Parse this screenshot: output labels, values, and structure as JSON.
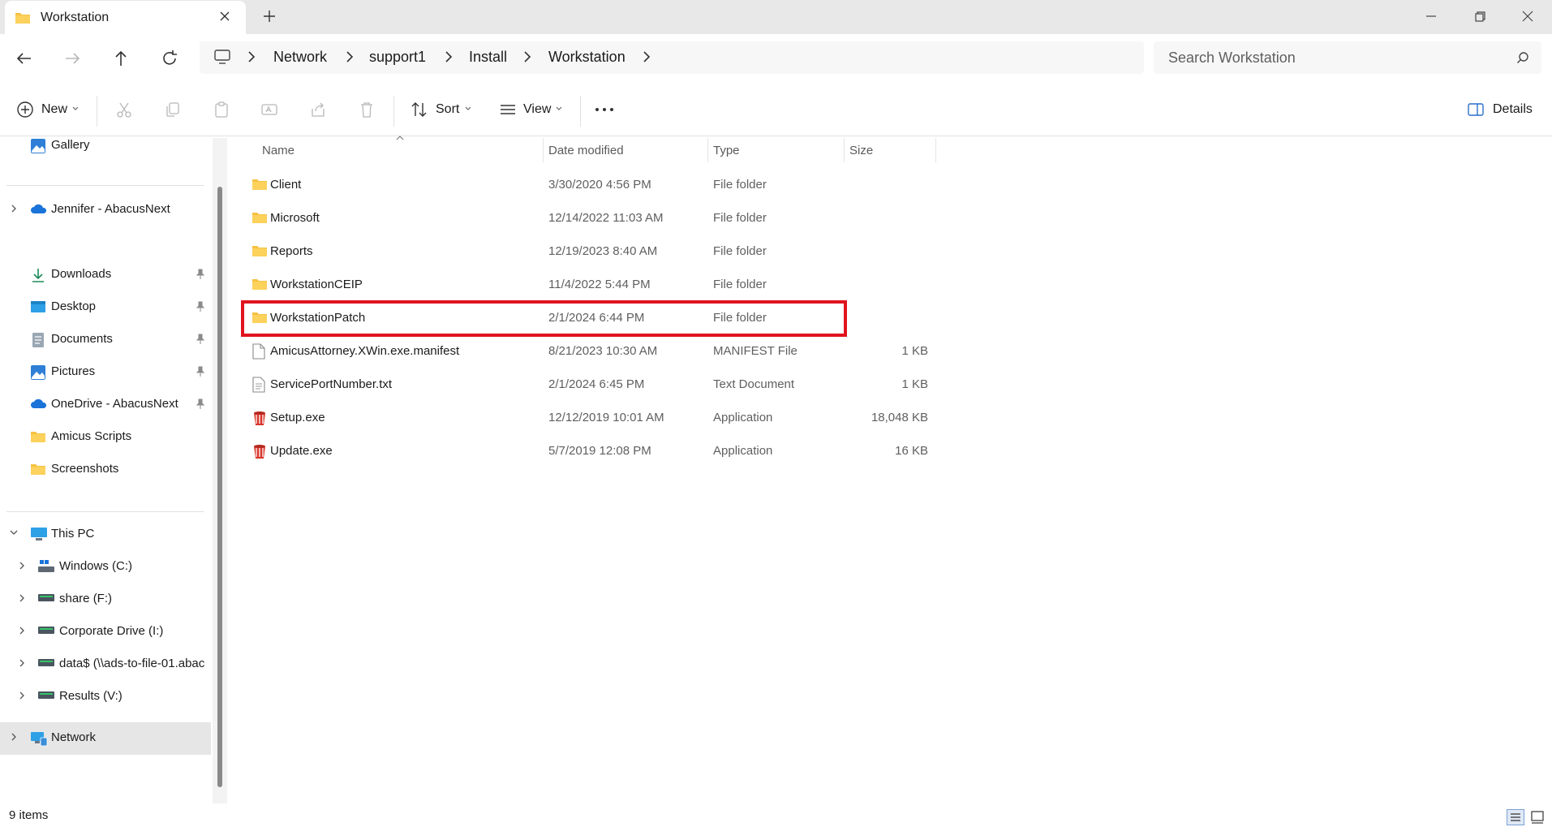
{
  "window": {
    "tab_title": "Workstation"
  },
  "address": {
    "crumbs": [
      "Network",
      "support1",
      "Install",
      "Workstation"
    ],
    "search_placeholder": "Search Workstation"
  },
  "toolbar": {
    "new_label": "New",
    "sort_label": "Sort",
    "view_label": "View",
    "details_label": "Details"
  },
  "sidebar": {
    "gallery": "Gallery",
    "onedrive_personal": "Jennifer - AbacusNext",
    "quick_access": [
      "Downloads",
      "Desktop",
      "Documents",
      "Pictures",
      "OneDrive - AbacusNext",
      "Amicus Scripts",
      "Screenshots"
    ],
    "this_pc": "This PC",
    "drives": [
      "Windows (C:)",
      "share (F:)",
      "Corporate Drive (I:)",
      "data$ (\\\\ads-to-file-01.abac",
      "Results (V:)"
    ],
    "network": "Network"
  },
  "columns": {
    "name": "Name",
    "date": "Date modified",
    "type": "Type",
    "size": "Size"
  },
  "files": [
    {
      "name": "Client",
      "date": "3/30/2020 4:56 PM",
      "type": "File folder",
      "size": "",
      "icon": "folder-icon"
    },
    {
      "name": "Microsoft",
      "date": "12/14/2022 11:03 AM",
      "type": "File folder",
      "size": "",
      "icon": "folder-icon"
    },
    {
      "name": "Reports",
      "date": "12/19/2023 8:40 AM",
      "type": "File folder",
      "size": "",
      "icon": "folder-icon"
    },
    {
      "name": "WorkstationCEIP",
      "date": "11/4/2022 5:44 PM",
      "type": "File folder",
      "size": "",
      "icon": "folder-icon"
    },
    {
      "name": "WorkstationPatch",
      "date": "2/1/2024 6:44 PM",
      "type": "File folder",
      "size": "",
      "icon": "folder-icon"
    },
    {
      "name": "AmicusAttorney.XWin.exe.manifest",
      "date": "8/21/2023 10:30 AM",
      "type": "MANIFEST File",
      "size": "1 KB",
      "icon": "file-icon"
    },
    {
      "name": "ServicePortNumber.txt",
      "date": "2/1/2024 6:45 PM",
      "type": "Text Document",
      "size": "1 KB",
      "icon": "text-file-icon"
    },
    {
      "name": "Setup.exe",
      "date": "12/12/2019 10:01 AM",
      "type": "Application",
      "size": "18,048 KB",
      "icon": "app-icon"
    },
    {
      "name": "Update.exe",
      "date": "5/7/2019 12:08 PM",
      "type": "Application",
      "size": "16 KB",
      "icon": "app-icon"
    }
  ],
  "status": {
    "item_count": "9 items"
  },
  "colors": {
    "highlight": "#e0141e",
    "folder": "#f6c142",
    "selected_sidebar": "#e6e6e6"
  }
}
